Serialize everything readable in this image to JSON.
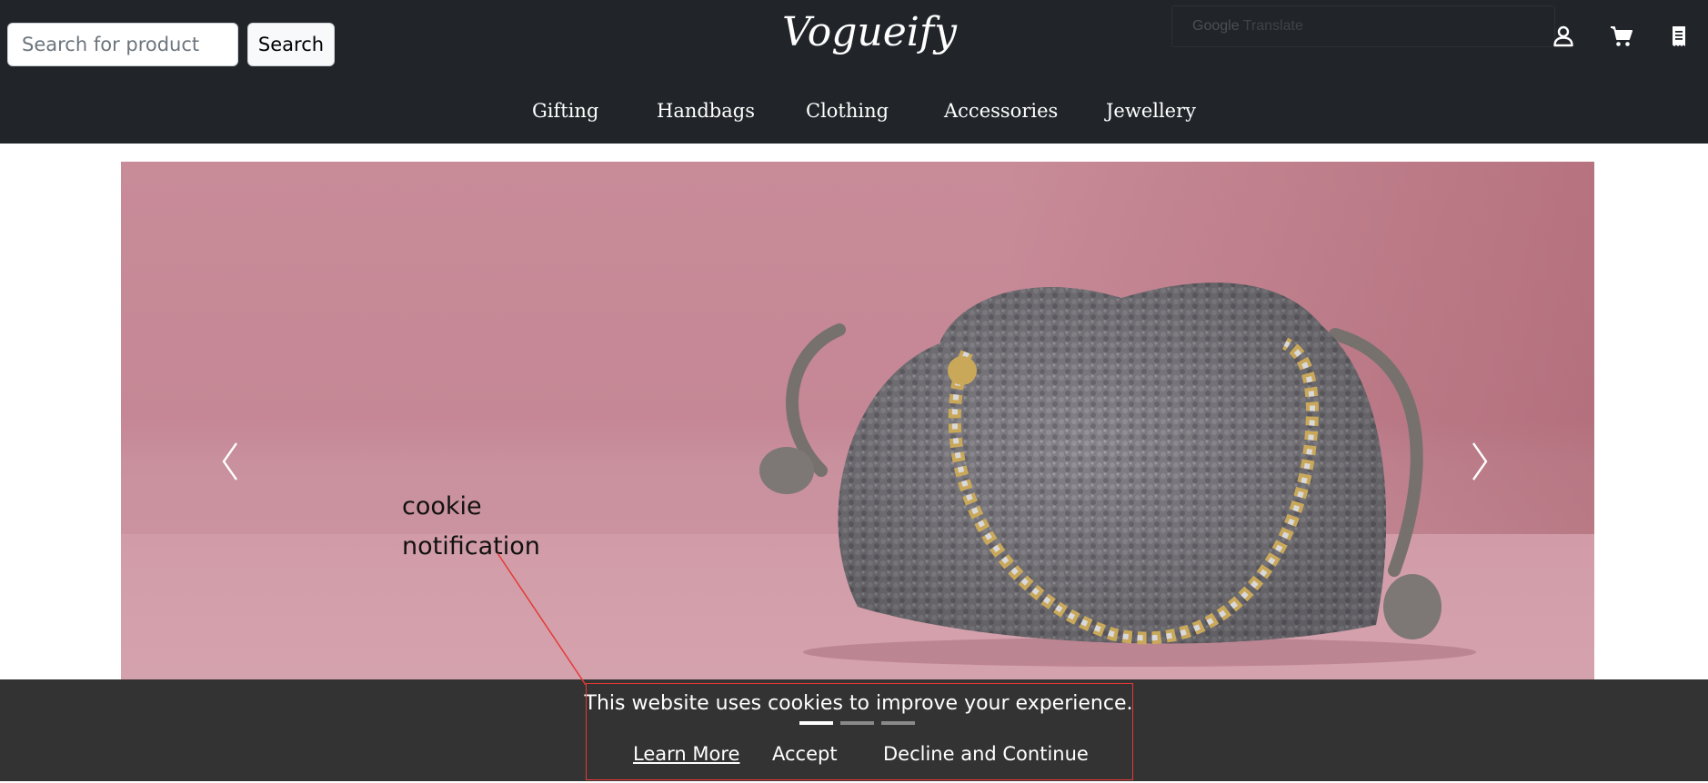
{
  "header": {
    "search_placeholder": "Search for product",
    "search_value": "",
    "search_button": "Search",
    "logo": "Vogueify",
    "translate": {
      "brand": "Google",
      "label": "Translate"
    },
    "icons": [
      "user-icon",
      "cart-icon",
      "receipt-icon"
    ]
  },
  "nav": {
    "items": [
      {
        "label": "Gifting"
      },
      {
        "label": "Handbags"
      },
      {
        "label": "Clothing"
      },
      {
        "label": "Accessories"
      },
      {
        "label": "Jewellery"
      }
    ]
  },
  "carousel": {
    "prev_icon": "chevron-left-icon",
    "next_icon": "chevron-right-icon",
    "active_slide": 1,
    "slide_count": 3
  },
  "annotation": {
    "line1": "cookie",
    "line2": "notification"
  },
  "cookie_banner": {
    "message": "This website uses cookies to improve your experience.",
    "learn_more": "Learn More",
    "accept": "Accept",
    "decline": "Decline and Continue"
  },
  "colors": {
    "header_bg": "#212529",
    "banner_bg": "#333333",
    "annotation": "#e53935",
    "hero_pink": "#c88b98"
  }
}
